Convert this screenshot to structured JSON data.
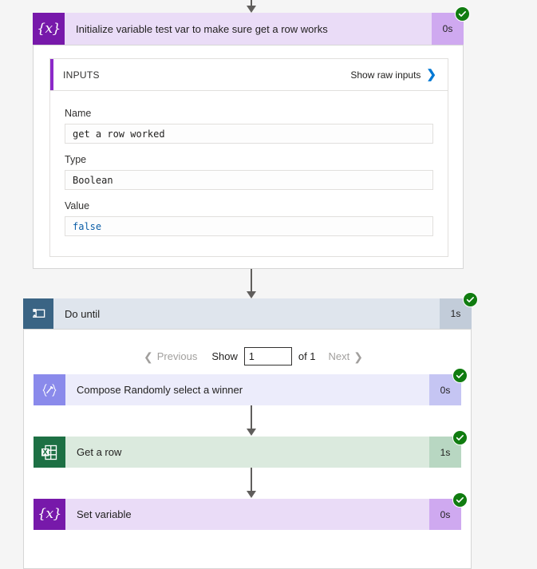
{
  "colors": {
    "page_background": "#f5f5f5",
    "variable_accent": "#7719aa",
    "compose_accent": "#8a8aeb",
    "excel_accent": "#1d7044",
    "loop_accent": "#3a6484",
    "success_green": "#107c10",
    "link_blue": "#0078d4",
    "literal_blue": "#0b5ea8"
  },
  "initialize_variable": {
    "title": "Initialize variable test var to make sure get a row works",
    "duration": "0s",
    "icon": "braces-x-icon",
    "status": "succeeded",
    "inputs": {
      "section_label": "INPUTS",
      "raw_link_label": "Show raw inputs",
      "raw_link_icon": "chevron-right-icon",
      "fields": [
        {
          "label": "Name",
          "value": "get a row worked",
          "literal": false
        },
        {
          "label": "Type",
          "value": "Boolean",
          "literal": false
        },
        {
          "label": "Value",
          "value": "false",
          "literal": true
        }
      ]
    }
  },
  "do_until": {
    "title": "Do until",
    "duration": "1s",
    "icon": "loop-icon",
    "status": "succeeded",
    "pager": {
      "previous_label": "Previous",
      "previous_icon": "chevron-left-icon",
      "show_label": "Show",
      "page_value": "1",
      "of_label": "of 1",
      "next_label": "Next",
      "next_icon": "chevron-right-icon"
    },
    "actions": [
      {
        "title": "Compose Randomly select a winner",
        "duration": "0s",
        "icon": "braces-pencil-icon",
        "theme": "compose",
        "status": "succeeded"
      },
      {
        "title": "Get a row",
        "duration": "1s",
        "icon": "excel-icon",
        "theme": "excel",
        "status": "succeeded"
      },
      {
        "title": "Set variable",
        "duration": "0s",
        "icon": "braces-x-icon",
        "theme": "variable",
        "status": "succeeded"
      }
    ]
  }
}
